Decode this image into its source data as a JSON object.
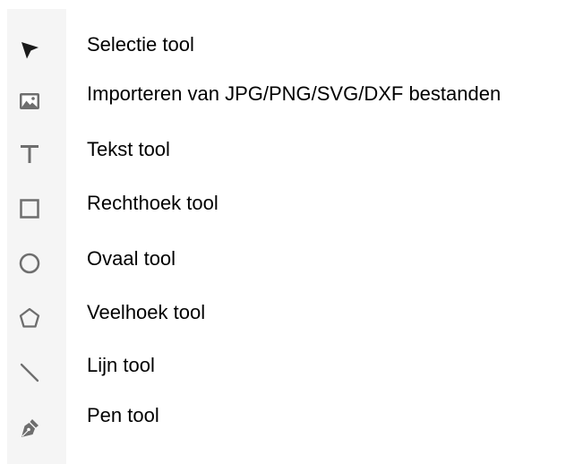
{
  "colors": {
    "strip_background": "#f5f5f5",
    "icon_dark": "#1a1a1a",
    "icon_gray": "#6e6e6e",
    "text": "#000000"
  },
  "tools": [
    {
      "icon": "selection-arrow-icon",
      "label": "Selectie tool"
    },
    {
      "icon": "image-import-icon",
      "label": "Importeren van JPG/PNG/SVG/DXF bestanden"
    },
    {
      "icon": "text-t-icon",
      "label": "Tekst tool"
    },
    {
      "icon": "rectangle-icon",
      "label": "Rechthoek tool"
    },
    {
      "icon": "oval-icon",
      "label": "Ovaal tool"
    },
    {
      "icon": "polygon-icon",
      "label": "Veelhoek tool"
    },
    {
      "icon": "line-icon",
      "label": "Lijn tool"
    },
    {
      "icon": "pen-nib-icon",
      "label": "Pen tool"
    }
  ]
}
